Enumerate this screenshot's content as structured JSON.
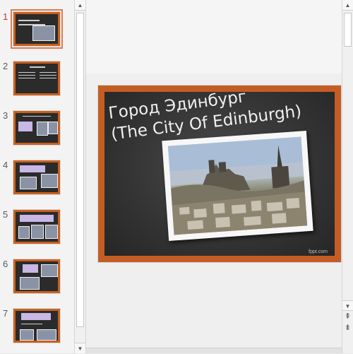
{
  "thumbnails": [
    {
      "number": "1",
      "active": true
    },
    {
      "number": "2",
      "active": false
    },
    {
      "number": "3",
      "active": false
    },
    {
      "number": "4",
      "active": false
    },
    {
      "number": "5",
      "active": false
    },
    {
      "number": "6",
      "active": false
    },
    {
      "number": "7",
      "active": false
    }
  ],
  "slide": {
    "title_line1": "Город Эдинбург",
    "title_line2": "(The City Of Edinburgh)",
    "credit": "fppt.com"
  },
  "scrollbar": {
    "up_icon": "▲",
    "down_icon": "▼",
    "prev_slide_icon": "⇞",
    "next_slide_icon": "⇟"
  },
  "colors": {
    "frame": "#c45d24",
    "board": "#333333",
    "active_number": "#c0392b"
  }
}
